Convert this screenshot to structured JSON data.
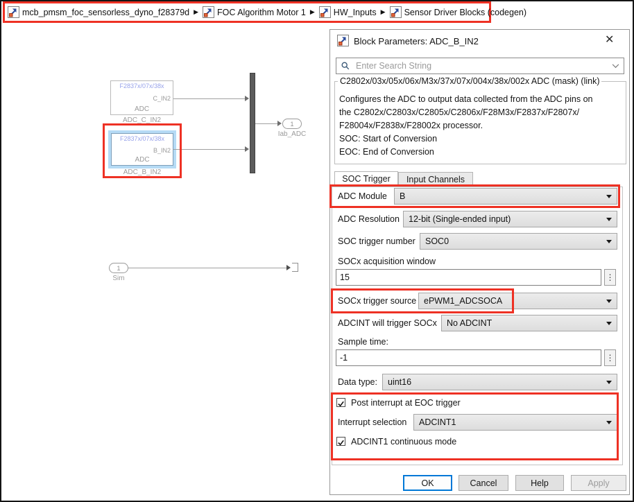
{
  "colors": {
    "annotation_red": "#ee3124",
    "selection_halo_blue": "#b6dbf5",
    "accent_blue": "#0078d7",
    "block_header_blue": "#97a2ea"
  },
  "breadcrumb": {
    "items": [
      {
        "label": "mcb_pmsm_foc_sensorless_dyno_f28379d"
      },
      {
        "label": "FOC Algorithm Motor 1"
      },
      {
        "label": "HW_Inputs"
      },
      {
        "label": "Sensor Driver Blocks (codegen)"
      }
    ],
    "separator": "▶"
  },
  "canvas": {
    "blocks": [
      {
        "header": "F2837x/07x/38x",
        "port": "C_IN2",
        "body": "ADC",
        "caption": "ADC_C_IN2",
        "selected": false
      },
      {
        "header": "F2837x/07x/38x",
        "port": "B_IN2",
        "body": "ADC",
        "caption": "ADC_B_IN2",
        "selected": true
      }
    ],
    "outport": {
      "number": "1",
      "label": "Iab_ADC"
    },
    "inport": {
      "number": "1",
      "label": "Sim"
    }
  },
  "dialog": {
    "title": "Block Parameters: ADC_B_IN2",
    "close_glyph": "✕",
    "search": {
      "placeholder": "Enter Search String"
    },
    "mask_title": "C2802x/03x/05x/06x/M3x/37x/07x/004x/38x/002x ADC (mask) (link)",
    "description_lines": {
      "l1": "Configures the ADC to output data collected from the ADC pins on",
      "l2": "the C2802x/C2803x/C2805x/C2806x/F28M3x/F2837x/F2807x/",
      "l3": "F28004x/F2838x/F28002x processor.",
      "l4": "SOC: Start of Conversion",
      "l5": "EOC: End of Conversion"
    },
    "tabs": [
      {
        "label": "SOC Trigger",
        "active": true
      },
      {
        "label": "Input Channels",
        "active": false
      }
    ],
    "fields": {
      "adc_module": {
        "label": "ADC Module",
        "value": "B"
      },
      "adc_resolution": {
        "label": "ADC Resolution",
        "value": "12-bit (Single-ended input)"
      },
      "soc_trigger_number": {
        "label": "SOC trigger number",
        "value": "SOC0"
      },
      "socx_acquisition_window": {
        "label": "SOCx acquisition window",
        "value": "15"
      },
      "socx_trigger_source": {
        "label": "SOCx trigger source",
        "value": "ePWM1_ADCSOCA"
      },
      "adcint_will_trigger": {
        "label": "ADCINT will trigger SOCx",
        "value": "No ADCINT"
      },
      "sample_time": {
        "label": "Sample time:",
        "value": "-1"
      },
      "data_type": {
        "label": "Data type:",
        "value": "uint16"
      },
      "post_interrupt": {
        "label": "Post interrupt at EOC trigger",
        "checked": true
      },
      "interrupt_selection": {
        "label": "Interrupt selection",
        "value": "ADCINT1"
      },
      "adcint1_continuous": {
        "label": "ADCINT1 continuous mode",
        "checked": true
      }
    },
    "buttons": [
      {
        "label": "OK",
        "enabled": true
      },
      {
        "label": "Cancel",
        "enabled": true
      },
      {
        "label": "Help",
        "enabled": true
      },
      {
        "label": "Apply",
        "enabled": false
      }
    ]
  }
}
